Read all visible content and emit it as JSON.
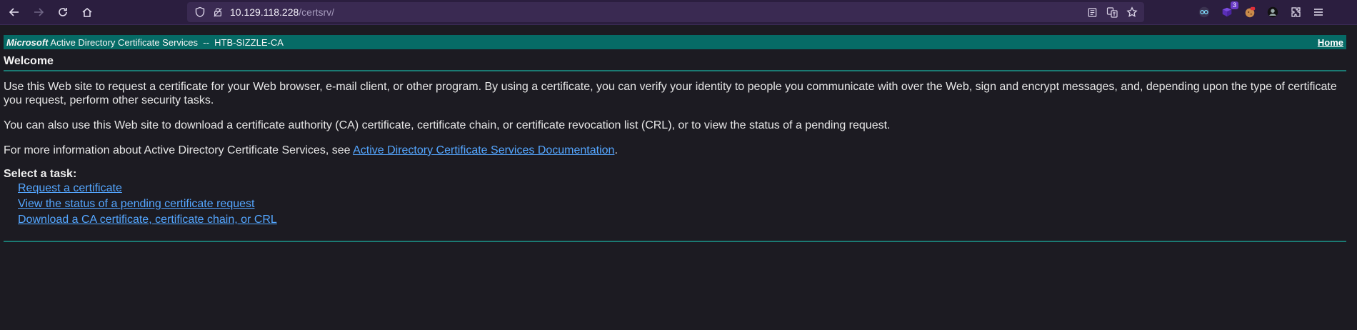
{
  "browser": {
    "url_host": "10.129.118.228",
    "url_path": "/certsrv/",
    "extension_badge": "3"
  },
  "header": {
    "brand": "Microsoft",
    "title": "Active Directory Certificate Services  --  HTB-SIZZLE-CA",
    "home_link": "Home"
  },
  "content": {
    "heading": "Welcome",
    "para1": "Use this Web site to request a certificate for your Web browser, e-mail client, or other program. By using a certificate, you can verify your identity to people you communicate with over the Web, sign and encrypt messages, and, depending upon the type of certificate you request, perform other security tasks.",
    "para2": "You can also use this Web site to download a certificate authority (CA) certificate, certificate chain, or certificate revocation list (CRL), or to view the status of a pending request.",
    "para3_prefix": "For more information about Active Directory Certificate Services, see ",
    "para3_link": "Active Directory Certificate Services Documentation",
    "para3_suffix": ".",
    "task_label": "Select a task:",
    "tasks": [
      "Request a certificate",
      "View the status of a pending certificate request",
      "Download a CA certificate, certificate chain, or CRL"
    ]
  }
}
